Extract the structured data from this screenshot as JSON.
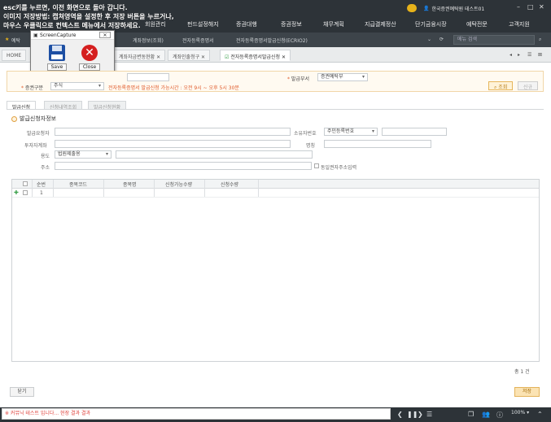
{
  "hint": {
    "line1": "esc키를 누르면, 이전 화면으로 돌아 갑니다.",
    "line2": "이미지 저장방법: 캡쳐영역을 설정한 후 저장 버튼을 누르거나,",
    "line3": "마우스 우클릭으로 컨텍스트 메뉴에서 저장하세요."
  },
  "header": {
    "user": "한국증권예탁원 테스트01",
    "menu": [
      "회원관리",
      "펀드설정해지",
      "증권대행",
      "증권정보",
      "채무계획",
      "지급결제정산",
      "단기금융시장",
      "예탁전문",
      "고객지원"
    ]
  },
  "breadcrumb": {
    "items": [
      "예탁",
      "계좌정보(조회)",
      "전자등록증명서",
      "전자등록증명서발급신청(ECRIO2)"
    ],
    "search_placeholder": "메뉴 검색"
  },
  "tabs": [
    {
      "label": "HOME",
      "active": false
    },
    {
      "label": "계좌자금변동현황",
      "active": false
    },
    {
      "label": "계좌인출청구",
      "active": false
    },
    {
      "label": "전자등록증명서발급신청",
      "active": true
    }
  ],
  "capture": {
    "title": "ScreenCapture",
    "save": "Save",
    "close": "Close"
  },
  "filter": {
    "issuer_label": "발급부서",
    "issuer_value": "증권예탁부",
    "type_label": "증권구분",
    "type_value": "주식",
    "notice": "전자등록증명서 발급신청 가능시간 : 오전 9시 ~ 오후 5시 30분",
    "search_btn": "조회",
    "reset_btn": "신규"
  },
  "subtabs": [
    "발급신청",
    "신청내역조회",
    "발급신청현황"
  ],
  "section_title": "발급신청자정보",
  "form": {
    "holder_label": "발급요청자",
    "owner_no_label": "소유자번호",
    "owner_no_select": "주민등록번호",
    "investor_label": "투자자계좌",
    "owner_name_label": "명칭",
    "purpose_label": "용도",
    "purpose_value": "법원제출용",
    "address_label": "주소",
    "same_address_label": "동일권자주소입력"
  },
  "grid": {
    "columns": [
      "순번",
      "종목코드",
      "종목명",
      "신청가능수량",
      "신청수량"
    ],
    "rows": [
      {
        "no": "1"
      }
    ]
  },
  "count_text": "총 1 건",
  "buttons": {
    "close": "닫기",
    "save": "저장"
  },
  "status": {
    "message": "※ 커뮤닉 테스트 입니다... 현장 결과 결과",
    "zoom": "100%"
  },
  "colors": {
    "topbar": "#2d3338",
    "accent_orange": "#e6b55a",
    "notice_red": "#e05a2a"
  }
}
